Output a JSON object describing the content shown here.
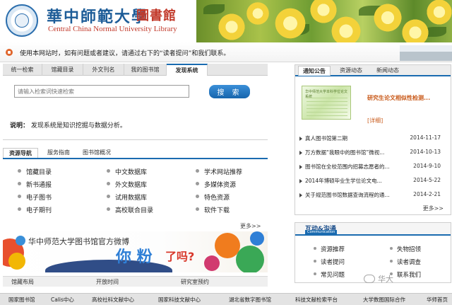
{
  "header": {
    "logo_cn": "華中師範大學",
    "logo_lib": "圖書館",
    "logo_en": "Central China Normal University Library"
  },
  "notice": {
    "text": "使用本网站时，如有问题或者建议，请通过右下的“读者提问”和我们联系。"
  },
  "nav_tabs": [
    {
      "label": "统一检索"
    },
    {
      "label": "馆藏目录"
    },
    {
      "label": "外文刊名"
    },
    {
      "label": "我的图书馆"
    },
    {
      "label": "发现系统"
    }
  ],
  "search": {
    "placeholder": "请输入检索词快速检索",
    "button": "搜 索"
  },
  "description": {
    "label": "说明：",
    "text": "发现系统是知识挖掘与数据分析。"
  },
  "resource_tabs": [
    {
      "label": "资源导航"
    },
    {
      "label": "服务指南"
    },
    {
      "label": "图书馆概况"
    }
  ],
  "resources": [
    [
      "馆藏目录",
      "中文数据库",
      "学术网站推荐"
    ],
    [
      "新书通报",
      "外文数据库",
      "多媒体资源"
    ],
    [
      "电子图书",
      "试用数据库",
      "特色资源"
    ],
    [
      "电子期刊",
      "高校联合目录",
      "软件下载"
    ]
  ],
  "more_left": "更多>>",
  "weibo": {
    "title": "华中师范大学图书馆官方微博",
    "big1": "你 粉",
    "big2": "了吗?"
  },
  "left_bar": [
    "馆藏布局",
    "开放时间",
    "研究室预约"
  ],
  "right_tabs": [
    {
      "label": "通知公告"
    },
    {
      "label": "资源动态"
    },
    {
      "label": "新闻动态"
    }
  ],
  "feature": {
    "thumb_text": "华中师范大学本科学位论文系统",
    "title": "研究生论文相似性检测...",
    "detail": "[详细]"
  },
  "news": [
    {
      "title": "真人图书馆第二期",
      "date": "2014-11-17"
    },
    {
      "title": "万方数据“我眼中的图书馆”微视...",
      "date": "2014-10-13"
    },
    {
      "title": "图书馆在全校范围内招募志愿者的...",
      "date": "2014-9-10"
    },
    {
      "title": "2014年博硕毕业生学位论文电...",
      "date": "2014-5-22"
    },
    {
      "title": "关于规范图书馆数据查询流程的通...",
      "date": "2014-2-21"
    }
  ],
  "more_right": "更多>>",
  "interact": {
    "title_cn": "互动&沟通",
    "title_en": "Communication",
    "links": [
      "资源推荐",
      "失物招领",
      "读者提问",
      "读者调查",
      "常见问题",
      "联系我们"
    ]
  },
  "watermark": "华大",
  "footer": [
    "国家图书馆",
    "Calis中心",
    "高校社科文献中心",
    "国家科技文献中心",
    "湖北省数字图书馆",
    "科技文献检索平台",
    "大学数图国际合作",
    "华师首页"
  ]
}
